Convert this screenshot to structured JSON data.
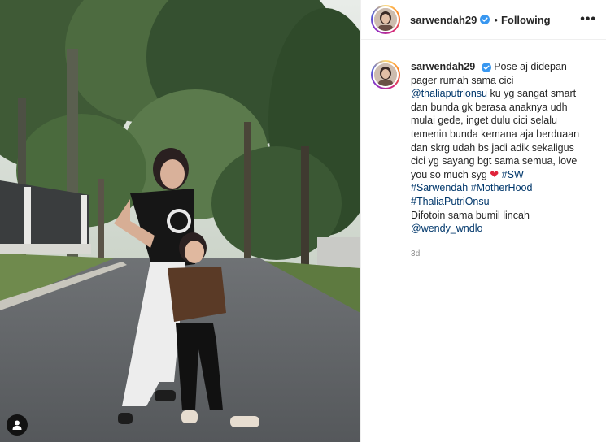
{
  "post": {
    "username": "sarwendah29",
    "follow_status": "Following",
    "dot": "•",
    "more": "•••",
    "caption": {
      "text_1": "Pose aj didepan pager rumah sama cici",
      "mention_1": "@thaliaputrionsu",
      "text_2": "ku yg sangat smart dan bunda gk berasa anaknya udh mulai gede, inget dulu cici selalu temenin bunda kemana aja berduaan dan skrg udah bs jadi adik sekaligus cici yg sayang bgt sama semua, love you so much syg",
      "heart": "❤",
      "hashtag_1": "#SW",
      "hashtag_2": "#Sarwendah",
      "hashtag_3": "#MotherHood",
      "hashtag_4": "#ThaliaPutriOnsu",
      "text_3": "Difotoin sama bumil lincah",
      "mention_2": "@wendy_wndlo"
    },
    "timestamp": "3d"
  },
  "colors": {
    "link": "#00376b",
    "verified": "#3897f0",
    "heart": "#e0243b",
    "muted": "#8e8e8e"
  },
  "icons": {
    "verified": "verified-badge-icon",
    "tag": "user-tag-icon",
    "more": "more-options-icon"
  }
}
